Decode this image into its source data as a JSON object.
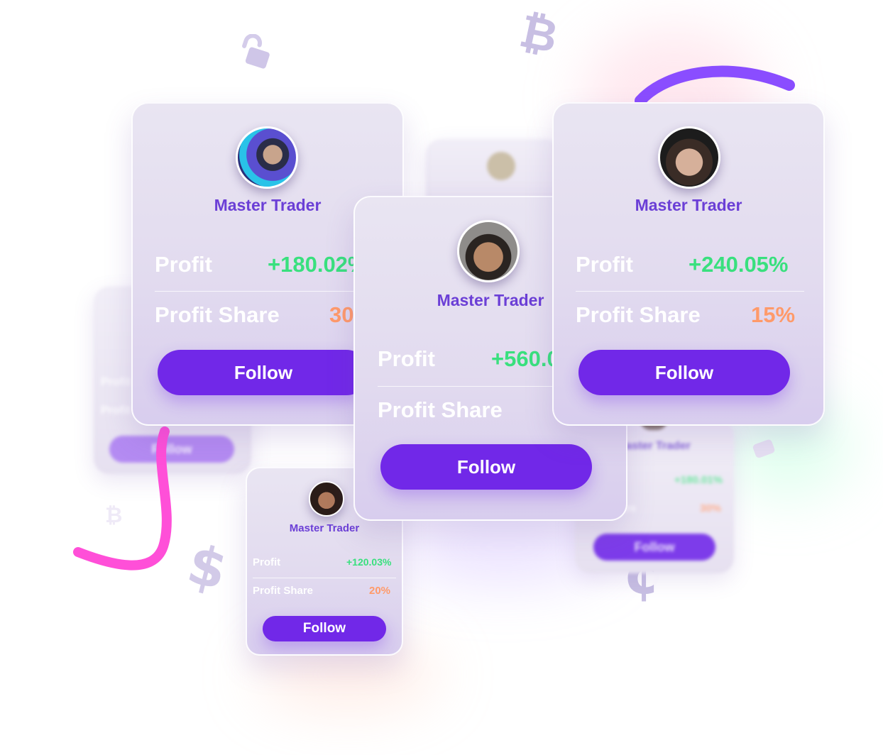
{
  "cards": {
    "left": {
      "title": "Master Trader",
      "profit_label": "Profit",
      "profit_value": "+180.02%",
      "share_label": "Profit Share",
      "share_value": "30%",
      "button": "Follow"
    },
    "center": {
      "title": "Master Trader",
      "profit_label": "Profit",
      "profit_value": "+560.00%",
      "share_label": "Profit Share",
      "button": "Follow"
    },
    "right": {
      "title": "Master Trader",
      "profit_label": "Profit",
      "profit_value": "+240.05%",
      "share_label": "Profit Share",
      "share_value": "15%",
      "button": "Follow"
    },
    "small": {
      "title": "Master Trader",
      "profit_label": "Profit",
      "profit_value": "+120.03%",
      "share_label": "Profit Share",
      "share_value": "20%",
      "button": "Follow"
    },
    "ghost_left": {
      "profit_label": "Profit",
      "share_label": "Profit",
      "button": "Follow"
    },
    "ghost_right": {
      "title": "Master Trader",
      "profit_value": "+180.01%",
      "share_label": "are",
      "share_value": "30%",
      "button": "Follow"
    }
  },
  "icons": {
    "bitcoin": "bitcoin-icon",
    "lock": "unlock-icon",
    "dollar": "dollar-icon",
    "cent": "cent-icon",
    "coin": "coin-icon"
  },
  "colors": {
    "accent": "#7128e8",
    "title": "#6b3fd6",
    "profit": "#39e07e",
    "share": "#ff9a6a",
    "swoosh_pink": "#ff4fd8",
    "swoosh_purple": "#8a4dff"
  }
}
